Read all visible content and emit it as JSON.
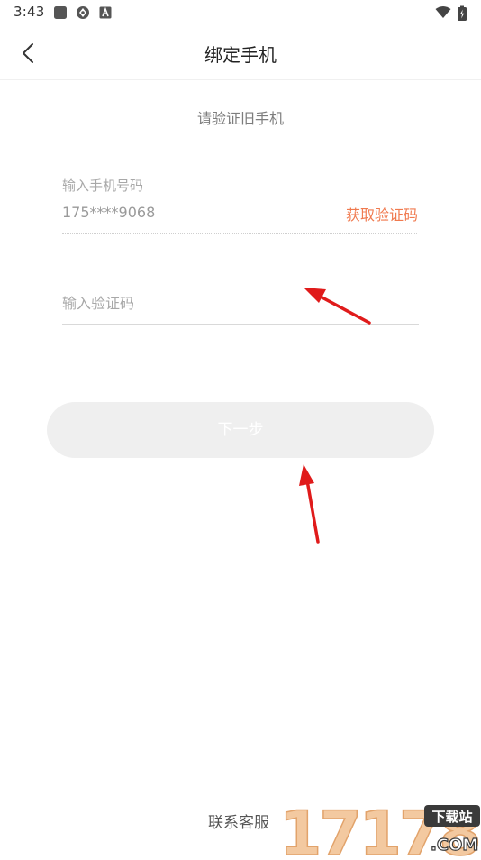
{
  "status_bar": {
    "time": "3:43"
  },
  "header": {
    "back_icon": "chevron-left-icon",
    "title": "绑定手机"
  },
  "subtitle": "请验证旧手机",
  "phone": {
    "label": "输入手机号码",
    "value": "175****9068",
    "get_code_label": "获取验证码"
  },
  "code": {
    "placeholder": "输入验证码",
    "value": ""
  },
  "next_button": {
    "label": "下一步"
  },
  "footer": {
    "contact_label": "联系客服"
  },
  "watermark": {
    "number": "17178",
    "badge": "下载站",
    "domain": ".COM"
  },
  "colors": {
    "accent": "#f07a4f",
    "button_disabled_bg": "#efefef",
    "annotation_arrow": "#e01b1b"
  }
}
